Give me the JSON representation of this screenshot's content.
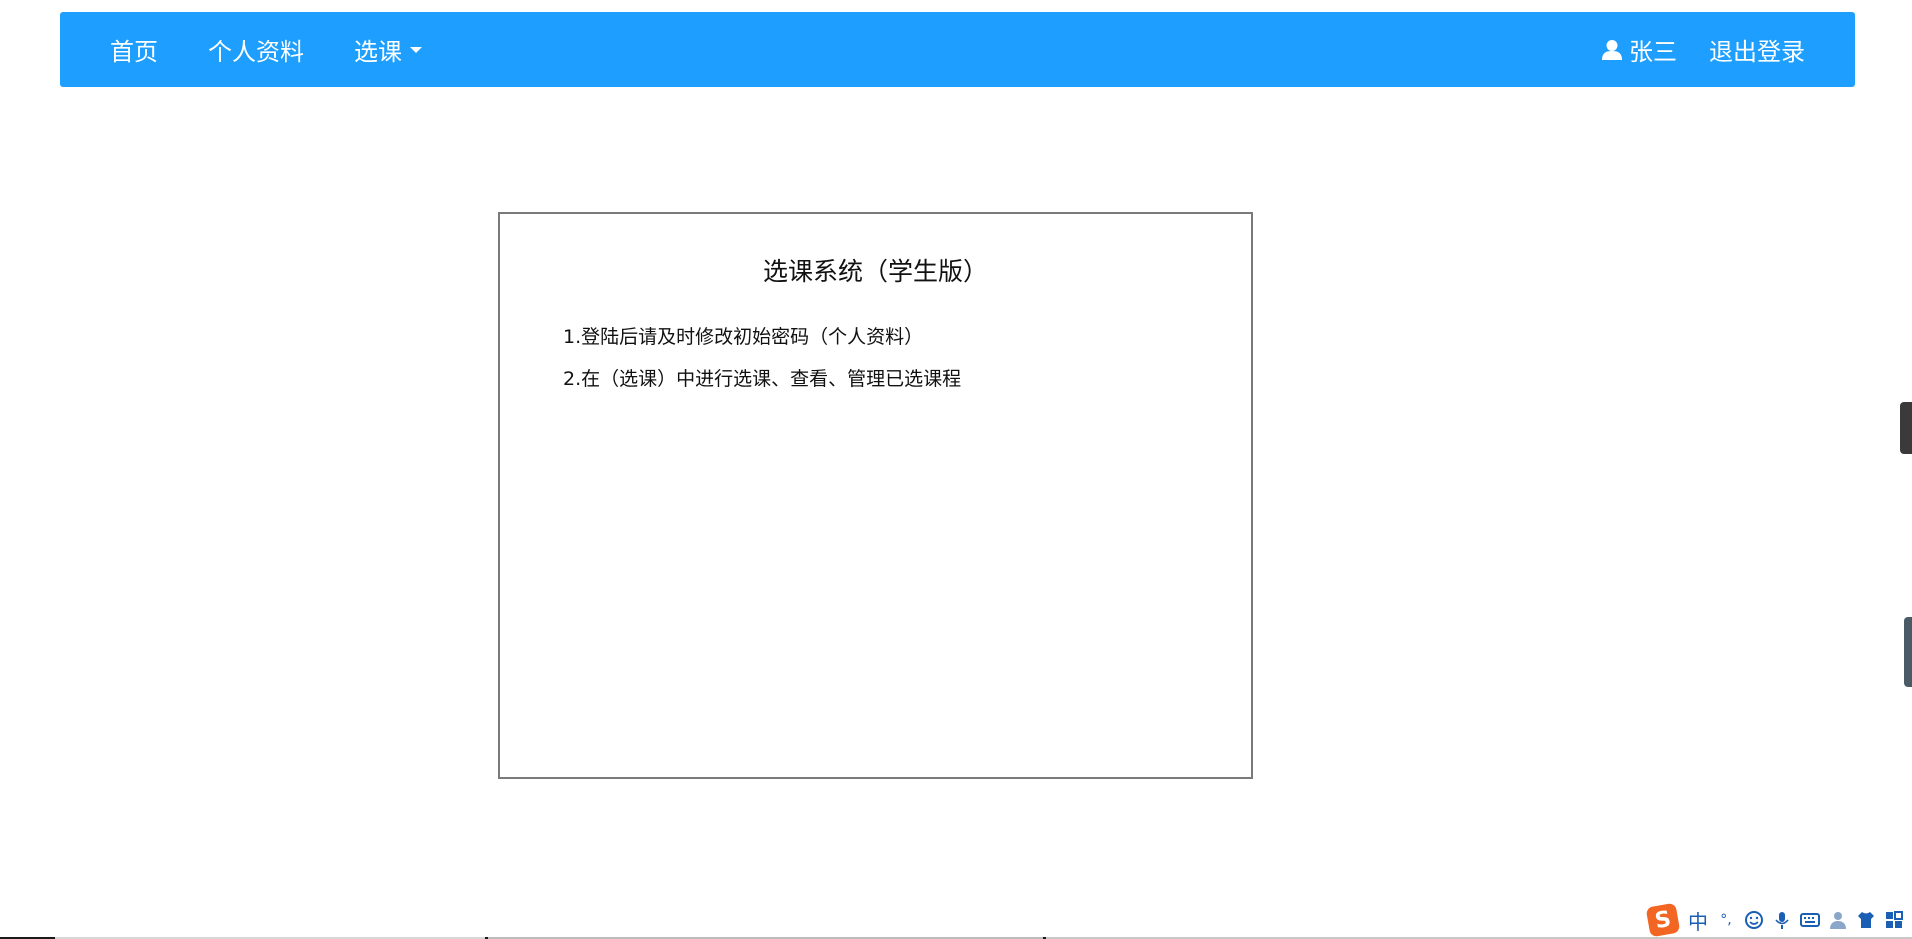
{
  "navbar": {
    "color": "#1e9fff",
    "items": [
      {
        "label": "首页"
      },
      {
        "label": "个人资料"
      },
      {
        "label": "选课"
      }
    ],
    "user_name": "张三",
    "logout_label": "退出登录"
  },
  "card": {
    "title": "选课系统（学生版）",
    "lines": [
      "1.登陆后请及时修改初始密码（个人资料）",
      "2.在（选课）中进行选课、查看、管理已选课程"
    ]
  },
  "ime_toolbar": {
    "logo": "S",
    "mode_label": "中",
    "punct_label": "°,",
    "icons": [
      "emoji-icon",
      "microphone-icon",
      "keyboard-icon",
      "user-icon",
      "shirt-icon",
      "grid-icon"
    ]
  }
}
